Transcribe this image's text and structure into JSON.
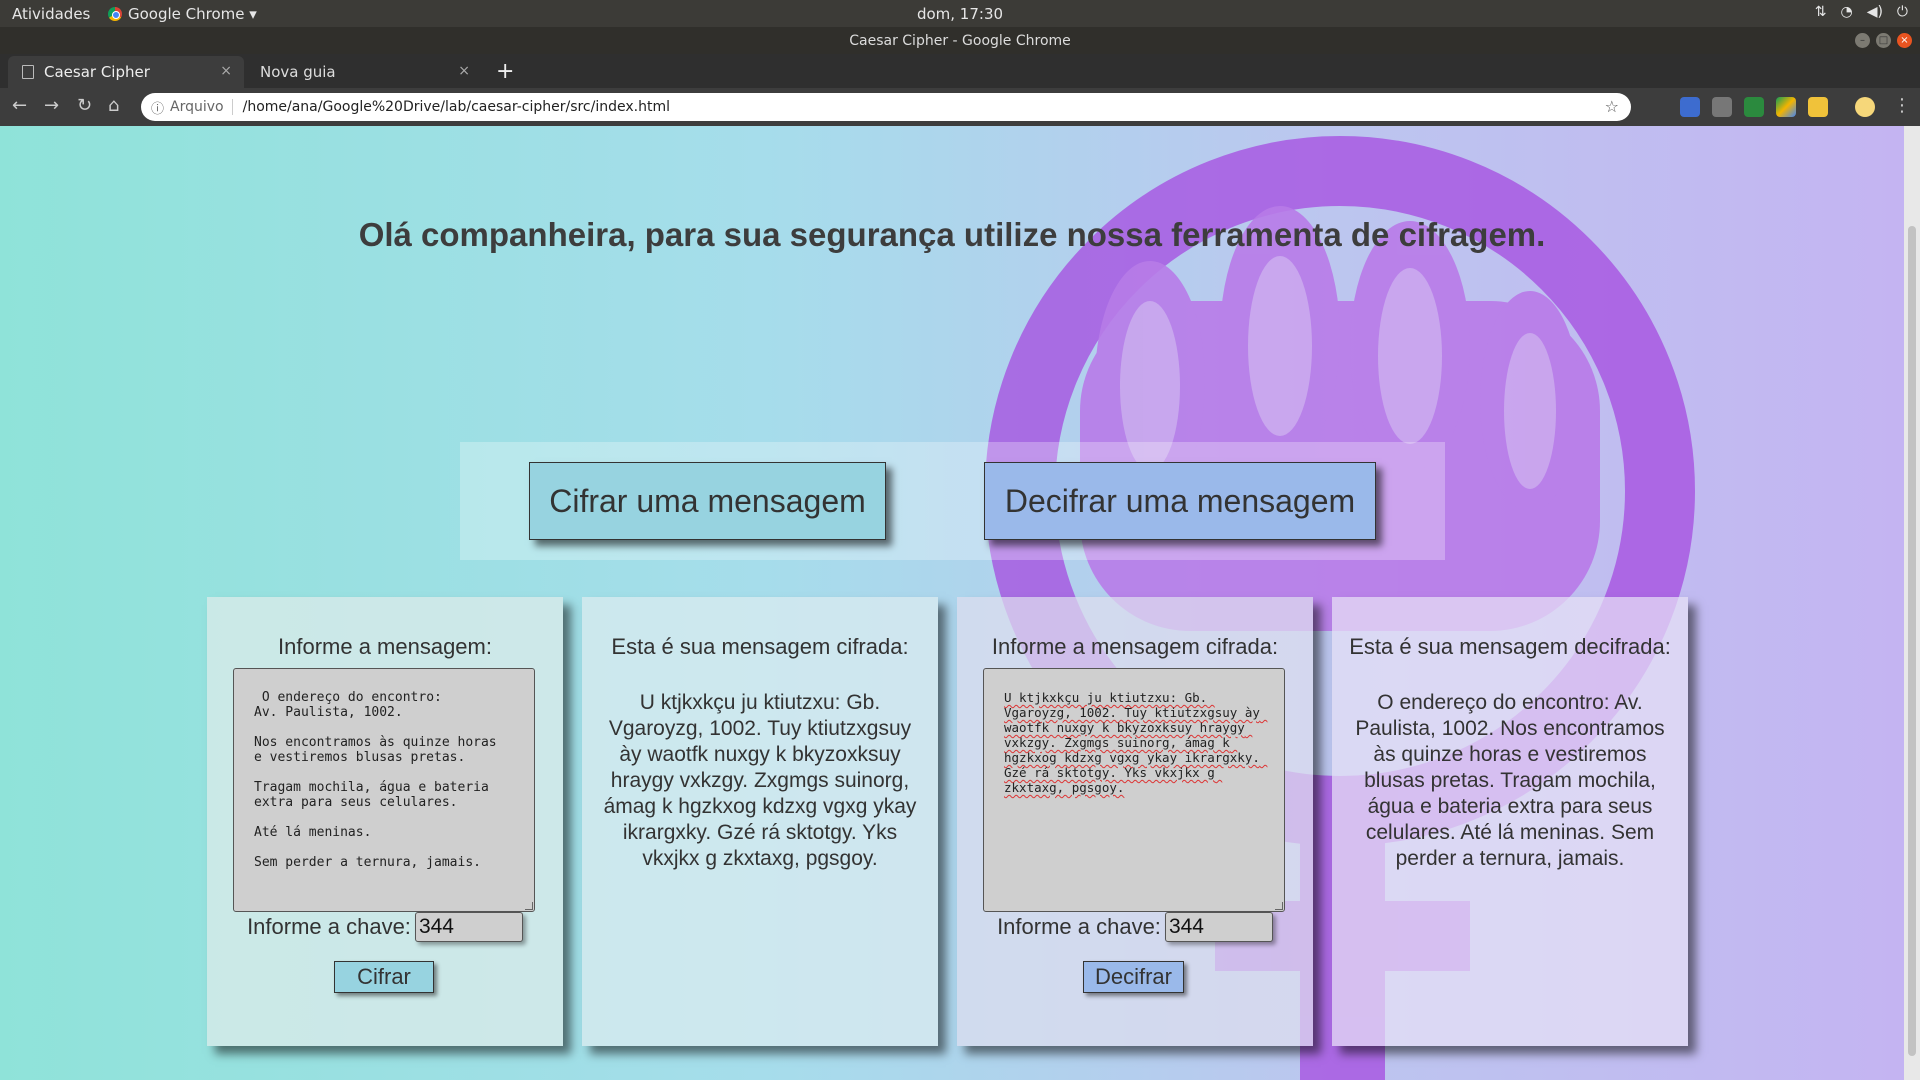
{
  "os": {
    "activities": "Atividades",
    "app_menu": "Google Chrome ▾",
    "clock": "dom, 17:30",
    "tray_icons": [
      "network-icon",
      "wifi-icon",
      "volume-icon",
      "power-icon"
    ]
  },
  "window": {
    "title": "Caesar Cipher - Google Chrome"
  },
  "tabs": [
    {
      "label": "Caesar Cipher",
      "active": true
    },
    {
      "label": "Nova guia",
      "active": false
    }
  ],
  "toolbar": {
    "info_icon": "ⓘ",
    "scheme": "Arquivo",
    "url": "/home/ana/Google%20Drive/lab/caesar-cipher/src/index.html"
  },
  "page": {
    "headline": "Olá companheira, para sua segurança utilize nossa ferramenta de cifragem.",
    "encrypt_mode_button": "Cifrar uma mensagem",
    "decrypt_mode_button": "Decifrar uma mensagem",
    "encrypt_panel": {
      "title": "Informe a mensagem:",
      "message": " O endereço do encontro:\nAv. Paulista, 1002.\n\nNos encontramos às quinze horas\ne vestiremos blusas pretas.\n\nTragam mochila, água e bateria\nextra para seus celulares.\n\nAté lá meninas.\n\nSem perder a ternura, jamais.",
      "key_label": "Informe a chave:",
      "key_value": "344",
      "button": "Cifrar"
    },
    "encrypted_panel": {
      "title": "Esta é sua mensagem cifrada:",
      "output": "U ktjkxkçu ju ktiutzxu: Gb. Vgaroyzg, 1002. Tuy ktiutzxgsuy ày waotfk nuxgy k bkyzoxksuy hraygy vxkzgy. Zxgmgs suinorg, ámag k hgzkxog kdzxg vgxg ykay ikrargxky. Gzé rá sktotgy. Yks vkxjkx g zkxtaxg, pgsgoy."
    },
    "decrypt_panel": {
      "title": "Informe a mensagem cifrada:",
      "message": "U ktjkxkçu ju ktiutzxu: Gb. Vgaroyzg, 1002. Tuy ktiutzxgsuy ày waotfk nuxgy k bkyzoxksuy hraygy vxkzgy. Zxgmgs suinorg, ámag k hgzkxog kdzxg vgxg ykay ikrargxky. Gzé rá sktotgy. Yks vkxjkx g zkxtaxg, pgsgoy.",
      "key_label": "Informe a chave:",
      "key_value": "344",
      "button": "Decifrar"
    },
    "decrypted_panel": {
      "title": "Esta é sua mensagem decifrada:",
      "output": "O endereço do encontro: Av. Paulista, 1002. Nos encontramos às quinze horas e vestiremos blusas pretas. Tragam mochila, água e bateria extra para seus celulares. Até lá meninas. Sem perder a ternura, jamais."
    }
  },
  "colors": {
    "encrypt_accent": "#97d3e0",
    "decrypt_accent": "#9ab9ea",
    "fist": "#a64ee0"
  }
}
